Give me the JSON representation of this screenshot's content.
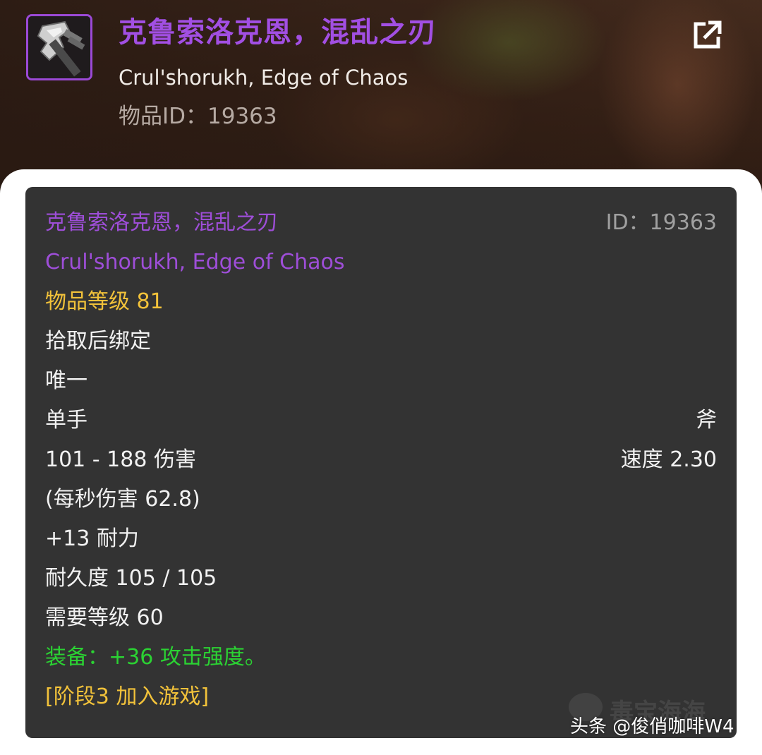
{
  "header": {
    "icon": "axe-item-icon",
    "title_cn": "克鲁索洛克恩，混乱之刃",
    "title_en": "Crul'shorukh, Edge of Chaos",
    "item_id": "物品ID：19363",
    "share_icon": "external-link-icon"
  },
  "tooltip": {
    "name_cn": "克鲁索洛克恩，混乱之刃",
    "id_label": "ID：19363",
    "name_en": "Crul'shorukh, Edge of Chaos",
    "item_level": "物品等级 81",
    "binding": "拾取后绑定",
    "unique": "唯一",
    "slot": "单手",
    "weapon_type": "斧",
    "damage": "101 - 188 伤害",
    "speed": "速度 2.30",
    "dps": "(每秒伤害 62.8)",
    "stamina": "+13 耐力",
    "durability": "耐久度 105 / 105",
    "required_level": "需要等级 60",
    "equip_effect": "装备：+36 攻击强度。",
    "phase": "[阶段3 加入游戏]"
  },
  "watermark": {
    "text": "毒宝海海",
    "credit": "头条 @俊俏咖啡W4"
  },
  "colors": {
    "epic_purple": "#9e4ed8",
    "gold": "#f2c23a",
    "equip_green": "#2bd233",
    "tooltip_bg": "#333333"
  }
}
